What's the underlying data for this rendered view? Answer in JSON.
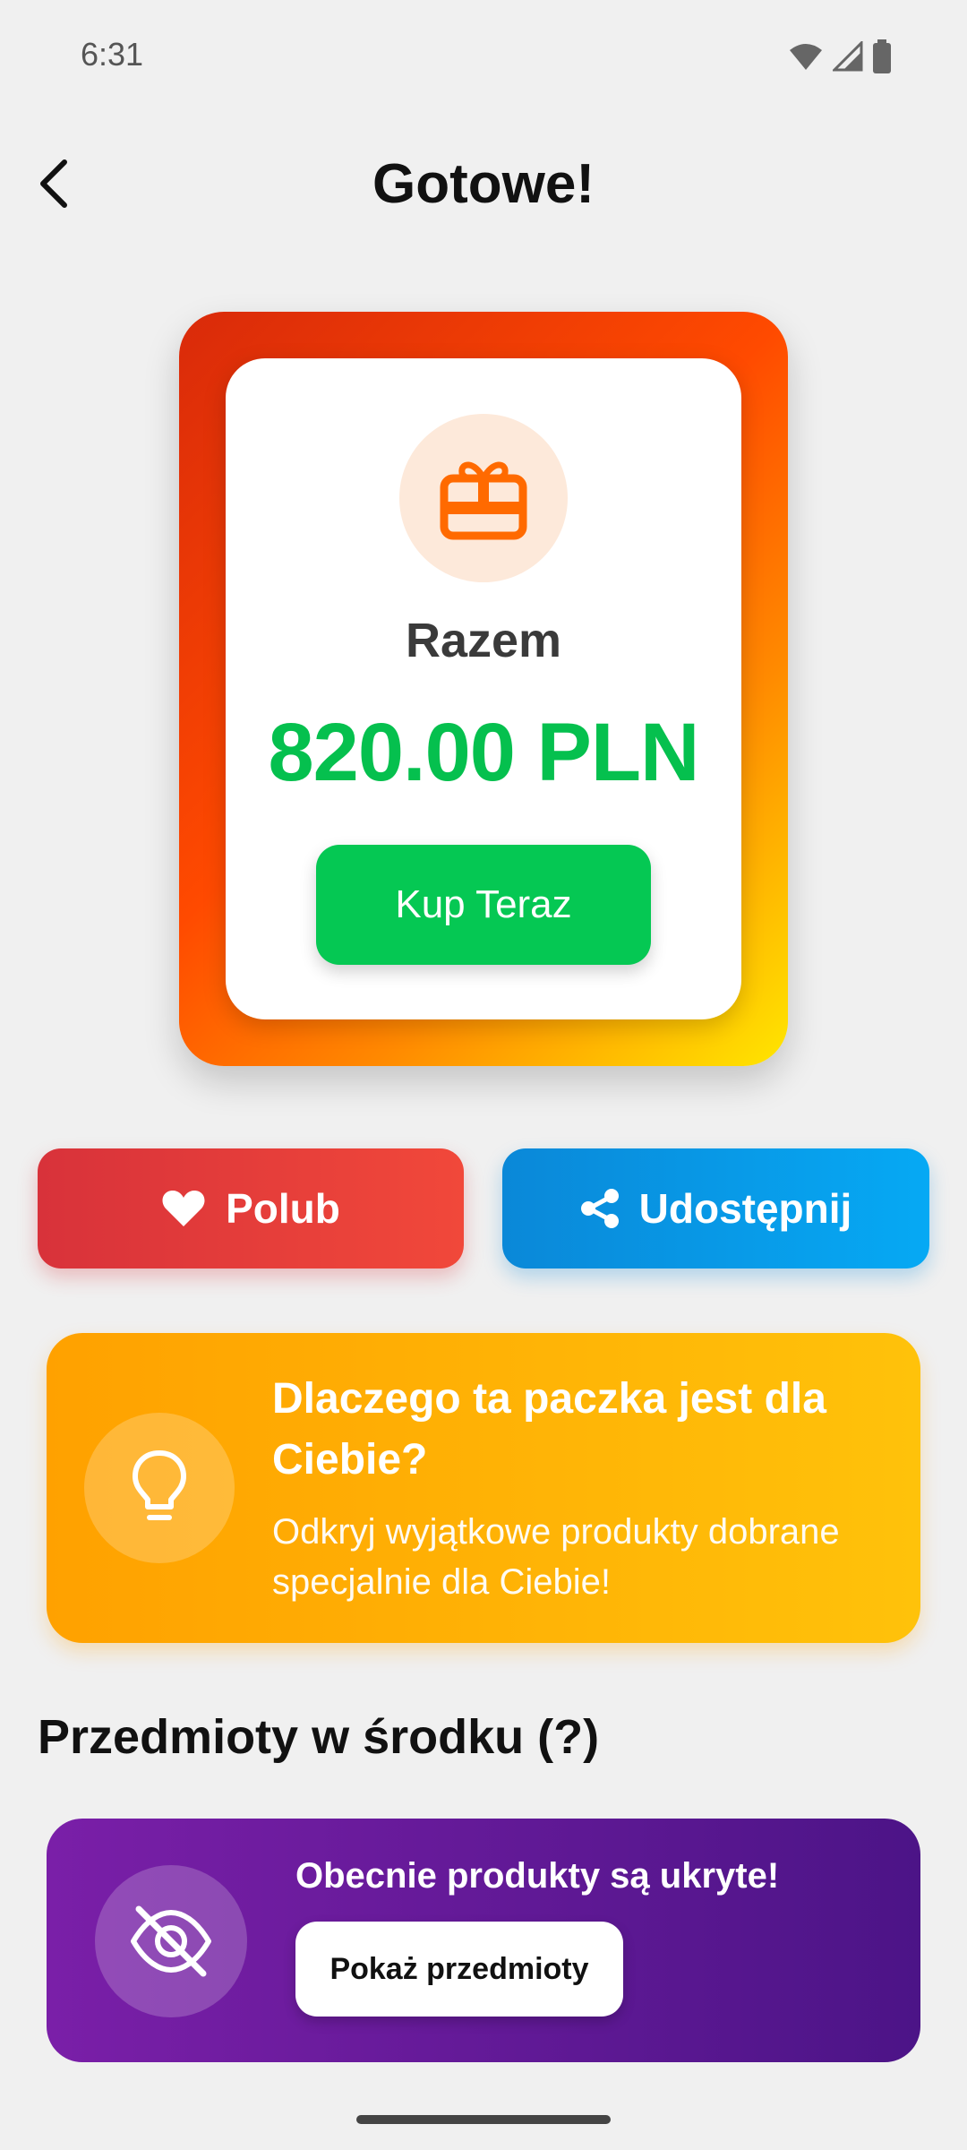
{
  "status_bar": {
    "time": "6:31"
  },
  "header": {
    "title": "Gotowe!"
  },
  "summary": {
    "label": "Razem",
    "price": "820.00 PLN",
    "buy_button": "Kup Teraz"
  },
  "actions": {
    "like": "Polub",
    "share": "Udostępnij"
  },
  "why_card": {
    "title": "Dlaczego ta paczka jest dla Ciebie?",
    "subtitle": "Odkryj wyjątkowe produkty dobrane specjalnie dla Ciebie!"
  },
  "items_section": {
    "title": "Przedmioty w środku (?)",
    "hidden_message": "Obecnie produkty są ukryte!",
    "show_button": "Pokaż przedmioty"
  },
  "icons": {
    "back": "chevron-left-icon",
    "gift": "gift-icon",
    "like": "heart-icon",
    "share": "share-icon",
    "tip": "lightbulb-icon",
    "hidden": "eye-off-icon"
  },
  "colors": {
    "price_green": "#05c04e",
    "buy_green": "#05c853",
    "like_red": "#e33d3a",
    "share_blue": "#0a98e6",
    "why_orange": "#ffb000",
    "hidden_purple": "#651a9a",
    "gift_orange": "#ff6a00"
  }
}
